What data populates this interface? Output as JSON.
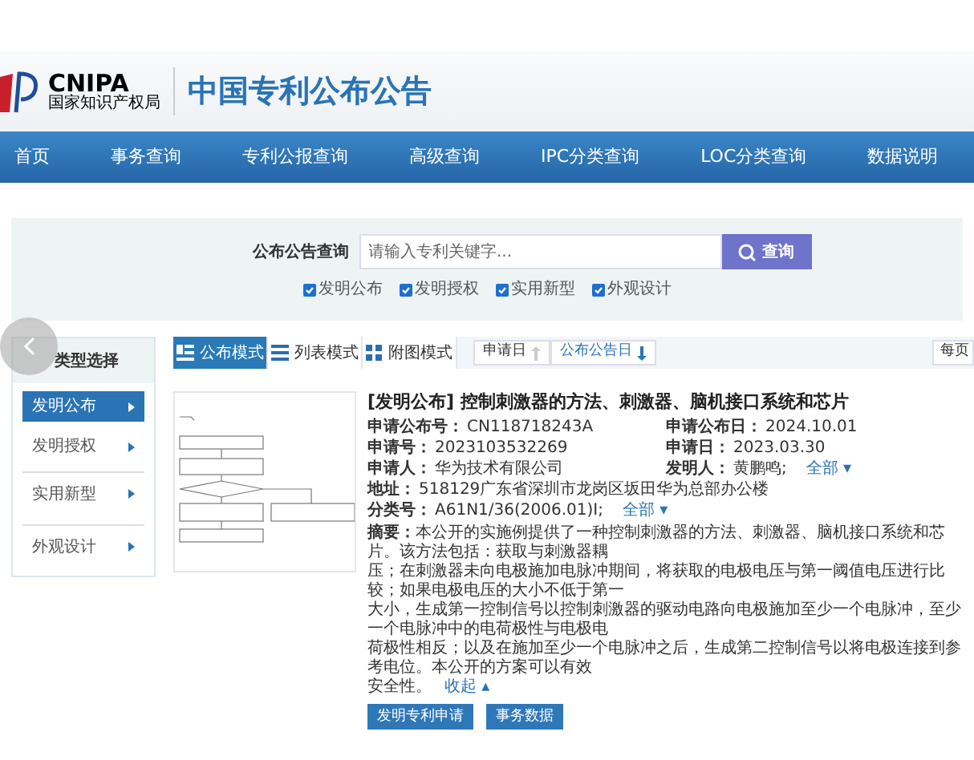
{
  "header": {
    "logo_text": "CNIPA",
    "logo_subtitle": "国家知识产权局",
    "site_title": "中国专利公布公告"
  },
  "nav": {
    "items": [
      "首页",
      "事务查询",
      "专利公报查询",
      "高级查询",
      "IPC分类查询",
      "LOC分类查询",
      "数据说明"
    ]
  },
  "search": {
    "label": "公布公告查询",
    "placeholder": "请输入专利关键字...",
    "button": "查询",
    "filters": [
      {
        "label": "发明公布",
        "checked": true
      },
      {
        "label": "发明授权",
        "checked": true
      },
      {
        "label": "实用新型",
        "checked": true
      },
      {
        "label": "外观设计",
        "checked": true
      }
    ]
  },
  "sidebar": {
    "title": "类型选择",
    "items": [
      {
        "label": "发明公布",
        "selected": true
      },
      {
        "label": "发明授权",
        "selected": false
      },
      {
        "label": "实用新型",
        "selected": false
      },
      {
        "label": "外观设计",
        "selected": false
      }
    ]
  },
  "view_modes": [
    {
      "label": "公布模式",
      "kind": "summary",
      "selected": true
    },
    {
      "label": "列表模式",
      "kind": "list",
      "selected": false
    },
    {
      "label": "附图模式",
      "kind": "grid",
      "selected": false
    }
  ],
  "sort": [
    {
      "label": "申请日",
      "ascending": true,
      "active": false
    },
    {
      "label": "公布公告日",
      "ascending": false,
      "active": true
    }
  ],
  "per_page_label": "每页",
  "result": {
    "title": "[发明公布] 控制刺激器的方法、刺激器、脑机接口系统和芯片",
    "fields": [
      {
        "label": "申请公布号：",
        "value": "CN118718243A"
      },
      {
        "label": "申请公布日：",
        "value": "2024.10.01"
      },
      {
        "label": "申请号：",
        "value": "2023103532269"
      },
      {
        "label": "申请日：",
        "value": "2023.03.30"
      },
      {
        "label": "申请人：",
        "value": "华为技术有限公司"
      },
      {
        "label": "发明人：",
        "value": "黄鹏鸣;",
        "more": "全部 ▾"
      }
    ],
    "address": {
      "label": "地址：",
      "value": "518129广东省深圳市龙岗区坂田华为总部办公楼"
    },
    "classification": {
      "label": "分类号：",
      "value": "A61N1/36(2006.01)I;",
      "more": "全部 ▾"
    },
    "abstract": {
      "lines": [
        "**摘要：**本公开的实施例提供了一种控制刺激器的方法、刺激器、脑机接口系统和芯片。该方法包括：获取与刺激器耦",
        "压；在刺激器未向电极施加电脉冲期间，将获取的电极电压与第一阈值电压进行比较；如果电极电压的大小不低于第一",
        "大小，生成第一控制信号以控制刺激器的驱动电路向电极施加至少一个电脉冲，至少一个电脉冲中的电荷极性与电极电",
        "荷极性相反；以及在施加至少一个电脉冲之后，生成第二控制信号以将电极连接到参考电位。本公开的方案可以有效",
        "安全性。"
      ],
      "collapse": "收起 ▴"
    },
    "buttons": [
      "发明专利申请",
      "事务数据"
    ]
  }
}
